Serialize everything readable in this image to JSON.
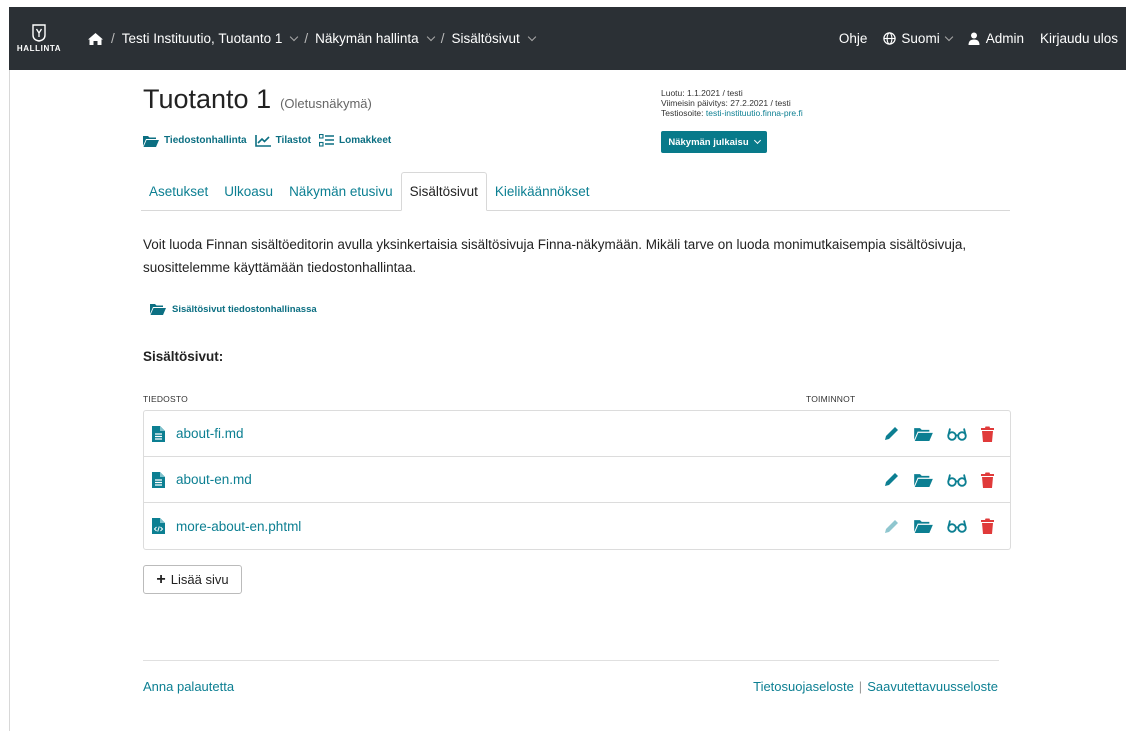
{
  "nav": {
    "brand_label": "HALLINTA",
    "breadcrumbs": [
      "Testi Instituutio, Tuotanto 1",
      "Näkymän hallinta",
      "Sisältösivut"
    ],
    "help": "Ohje",
    "language": "Suomi",
    "user": "Admin",
    "logout": "Kirjaudu ulos"
  },
  "header": {
    "title": "Tuotanto 1",
    "subtitle": "(Oletusnäkymä)",
    "tools": [
      "Tiedostonhallinta",
      "Tilastot",
      "Lomakkeet"
    ],
    "created": "Luotu: 1.1.2021 / testi",
    "updated": "Viimeisin päivitys: 27.2.2021 / testi",
    "test_address_label": "Testiosoite:",
    "test_address": "testi-instituutio.finna-pre.fi",
    "publish_button": "Näkymän julkaisu"
  },
  "tabs": [
    {
      "label": "Asetukset",
      "active": false
    },
    {
      "label": "Ulkoasu",
      "active": false
    },
    {
      "label": "Näkymän etusivu",
      "active": false
    },
    {
      "label": "Sisältösivut",
      "active": true
    },
    {
      "label": "Kielikäännökset",
      "active": false
    }
  ],
  "intro": "Voit luoda Finnan sisältöeditorin avulla yksinkertaisia sisältösivuja Finna-näkymään. Mikäli tarve on luoda monimutkaisempia sisältösivuja, suosittelemme käyttämään tiedostonhallintaa.",
  "file_manager_link": "Sisältösivut tiedostonhallinassa",
  "section_title": "Sisältösivut:",
  "table": {
    "col_file": "TIEDOSTO",
    "col_actions": "TOIMINNOT",
    "rows": [
      {
        "name": "about-fi.md",
        "type": "text-file-icon",
        "edit_enabled": true
      },
      {
        "name": "about-en.md",
        "type": "text-file-icon",
        "edit_enabled": true
      },
      {
        "name": "more-about-en.phtml",
        "type": "code-file-icon",
        "edit_enabled": false
      }
    ]
  },
  "add_button": "Lisää sivu",
  "footer": {
    "feedback": "Anna palautetta",
    "privacy": "Tietosuojaseloste",
    "accessibility": "Saavutettavuusseloste"
  },
  "colors": {
    "accent": "#0c7f92",
    "topbar": "#2b3035",
    "delete": "#e03a3a",
    "publish": "#087a8a"
  }
}
